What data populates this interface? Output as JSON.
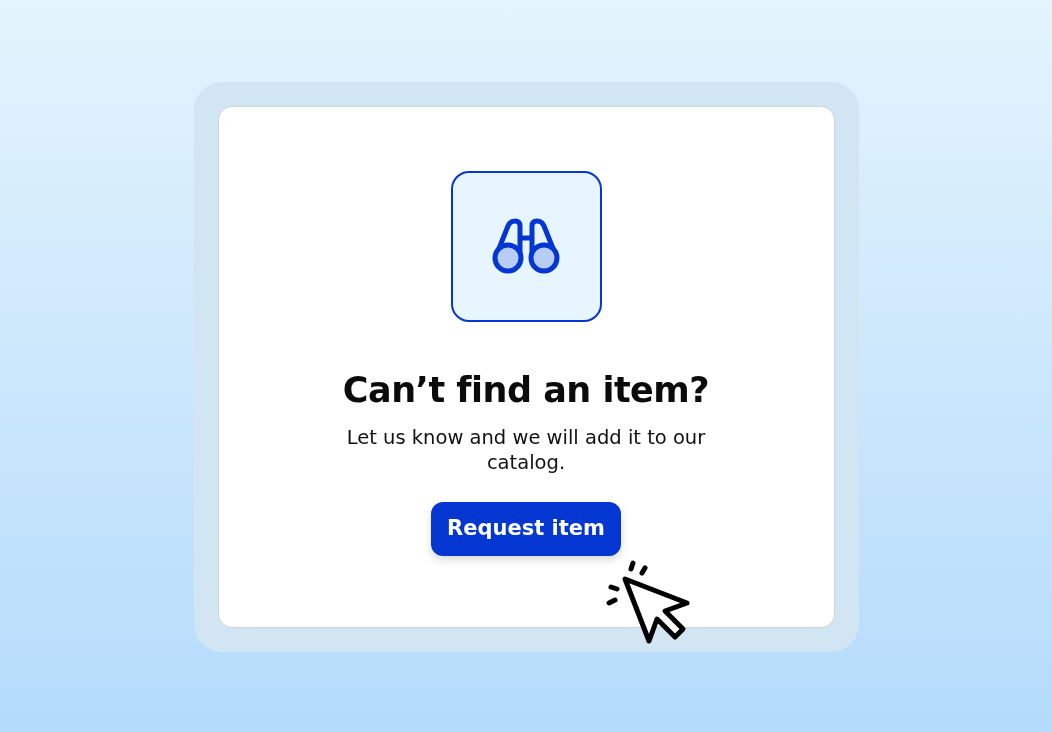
{
  "empty_state": {
    "title": "Can’t find an item?",
    "message": "Let us know and we will add it to our catalog.",
    "button": {
      "label": "Request item"
    }
  }
}
